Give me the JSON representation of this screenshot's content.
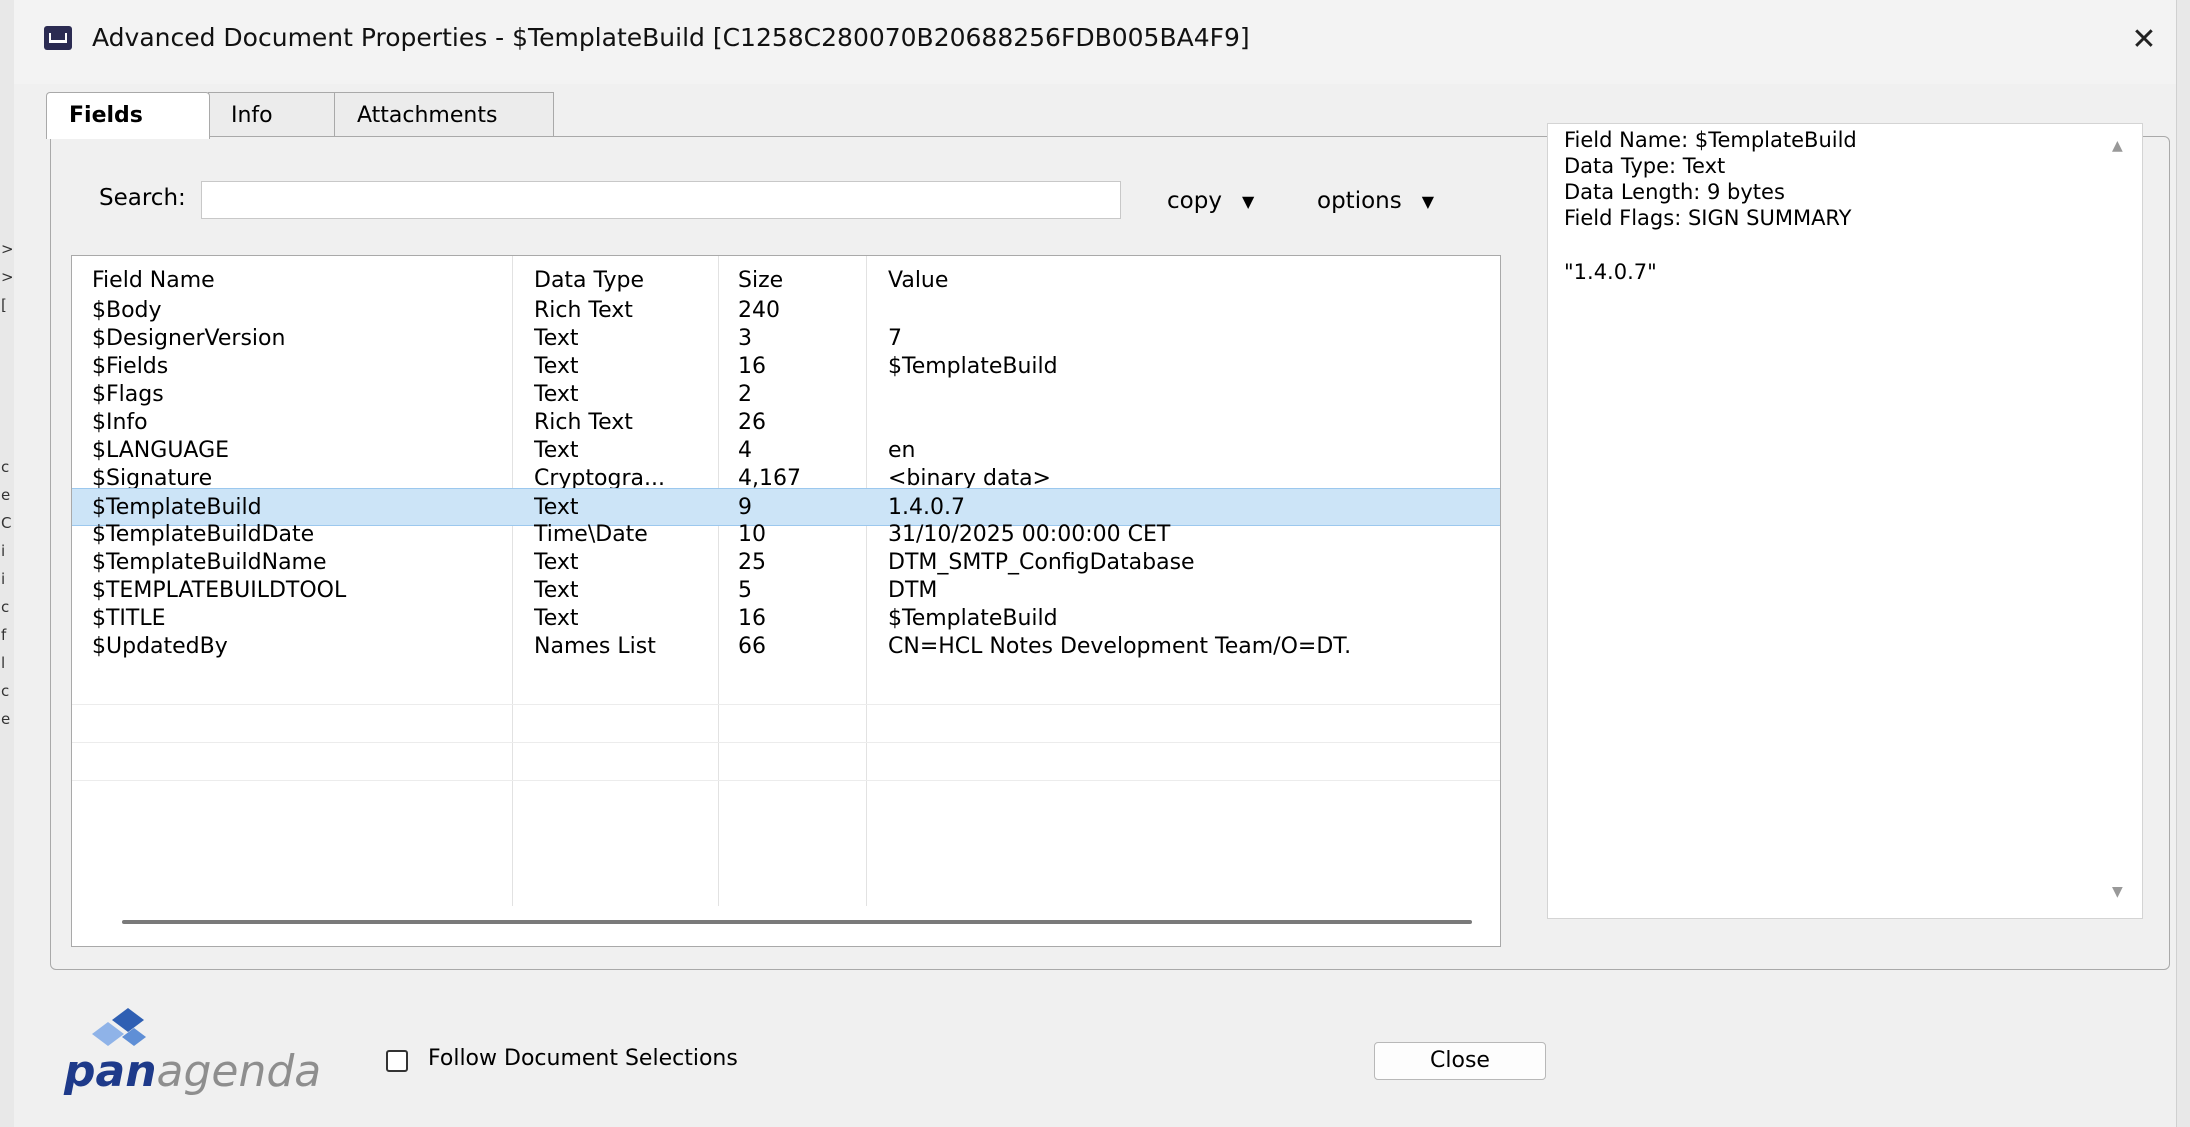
{
  "window": {
    "title": "Advanced Document Properties - $TemplateBuild [C1258C280070B20688256FDB005BA4F9]"
  },
  "tabs": [
    {
      "label": "Fields"
    },
    {
      "label": "Info"
    },
    {
      "label": "Attachments"
    }
  ],
  "search": {
    "label": "Search:",
    "value": "",
    "placeholder": ""
  },
  "menus": {
    "copy_label": "copy",
    "options_label": "options"
  },
  "table": {
    "columns": [
      "Field Name",
      "Data Type",
      "Size",
      "Value"
    ],
    "rows": [
      {
        "name": "$Body",
        "type": "Rich Text",
        "size": "240",
        "value": ""
      },
      {
        "name": "$DesignerVersion",
        "type": "Text",
        "size": "3",
        "value": "7"
      },
      {
        "name": "$Fields",
        "type": "Text",
        "size": "16",
        "value": "$TemplateBuild"
      },
      {
        "name": "$Flags",
        "type": "Text",
        "size": "2",
        "value": ""
      },
      {
        "name": "$Info",
        "type": "Rich Text",
        "size": "26",
        "value": ""
      },
      {
        "name": "$LANGUAGE",
        "type": "Text",
        "size": "4",
        "value": "en"
      },
      {
        "name": "$Signature",
        "type": "Cryptogra...",
        "size": "4,167",
        "value": "<binary data>"
      },
      {
        "name": "$TemplateBuild",
        "type": "Text",
        "size": "9",
        "value": "1.4.0.7"
      },
      {
        "name": "$TemplateBuildDate",
        "type": "Time\\Date",
        "size": "10",
        "value": "31/10/2025 00:00:00 CET"
      },
      {
        "name": "$TemplateBuildName",
        "type": "Text",
        "size": "25",
        "value": "DTM_SMTP_ConfigDatabase"
      },
      {
        "name": "$TEMPLATEBUILDTOOL",
        "type": "Text",
        "size": "5",
        "value": "DTM"
      },
      {
        "name": "$TITLE",
        "type": "Text",
        "size": "16",
        "value": "$TemplateBuild"
      },
      {
        "name": "$UpdatedBy",
        "type": "Names List",
        "size": "66",
        "value": "CN=HCL Notes Development Team/O=DT."
      }
    ],
    "selected_row": "$TemplateBuild"
  },
  "detail": {
    "lines": [
      "Field Name: $TemplateBuild",
      "Data Type: Text",
      "Data Length: 9 bytes",
      "Field Flags: SIGN SUMMARY"
    ],
    "value": "\"1.4.0.7\""
  },
  "footer": {
    "logo_bold": "pan",
    "logo_light": "agenda",
    "follow_label": "Follow Document Selections",
    "follow_checked": false,
    "close_label": "Close"
  },
  "colors": {
    "selection": "#cce4f7",
    "logo_blue": "#1e3a8a",
    "background": "#f0f0f0"
  }
}
